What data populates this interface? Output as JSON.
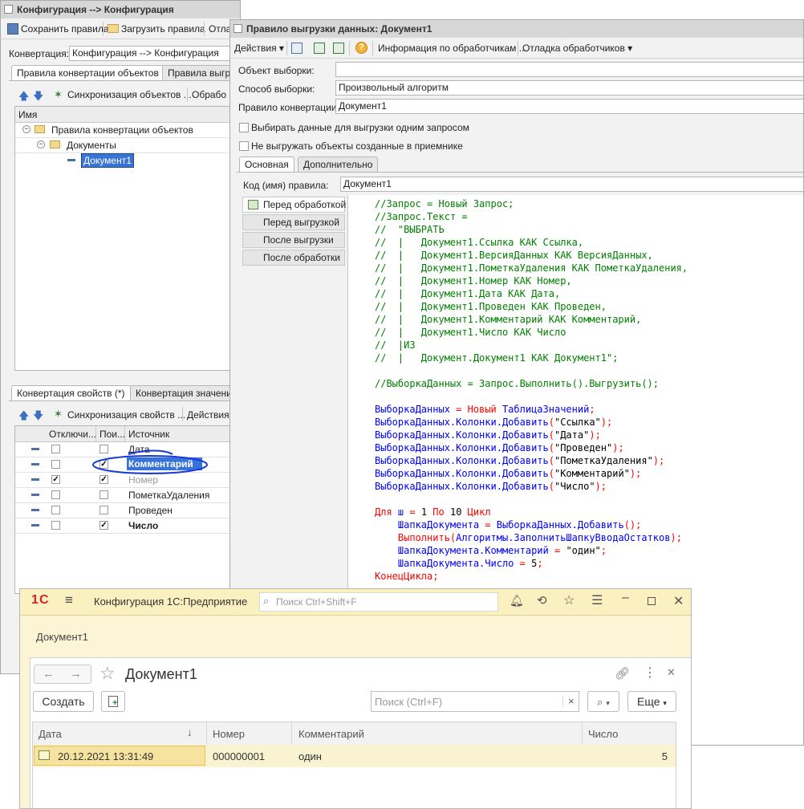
{
  "main_window": {
    "title": "Конфигурация --> Конфигурация",
    "toolbar": {
      "save": "Сохранить правила",
      "load": "Загрузить правила",
      "cut": "Отла"
    },
    "conversion_label": "Конвертация:",
    "conversion_value": "Конфигурация --> Конфигурация",
    "tabs": [
      "Правила конвертации объектов",
      "Правила выгру"
    ],
    "tree_toolbar": {
      "sync": "Синхронизация объектов ...",
      "process": "Обрабо"
    },
    "tree_header": "Имя",
    "tree": [
      {
        "label": "Правила конвертации объектов"
      },
      {
        "label": "Документы"
      },
      {
        "label": "Документ1"
      }
    ],
    "bottom_tabs": [
      "Конвертация свойств (*)",
      "Конвертация значени"
    ],
    "prop_toolbar": {
      "sync": "Синхронизация свойств ...",
      "actions": "Действия"
    },
    "prop_headers": [
      "Отключи...",
      "Пои...",
      "Источник"
    ],
    "prop_rows": [
      {
        "disabled": false,
        "search": false,
        "source": "Дата"
      },
      {
        "disabled": false,
        "search": true,
        "source": "Комментарий"
      },
      {
        "disabled": true,
        "search": true,
        "source": "Номер"
      },
      {
        "disabled": false,
        "search": false,
        "source": "ПометкаУдаления"
      },
      {
        "disabled": false,
        "search": false,
        "source": "Проведен"
      },
      {
        "disabled": false,
        "search": true,
        "source": "Число"
      }
    ]
  },
  "rule_window": {
    "title": "Правило выгрузки данных: Документ1",
    "toolbar": {
      "actions": "Действия",
      "info": "Информация по обработчикам ...",
      "debug": "Отладка обработчиков"
    },
    "fields": {
      "object_label": "Объект выборки:",
      "object_value": "",
      "method_label": "Способ выборки:",
      "method_value": "Произвольный алгоритм",
      "rule_label": "Правило конвертации:",
      "rule_value": "Документ1"
    },
    "checks": {
      "one_query": "Выбирать данные для выгрузки одним запросом",
      "no_export": "Не выгружать объекты созданные в приемнике"
    },
    "tabs": [
      "Основная",
      "Дополнительно"
    ],
    "code_label": "Код (имя) правила:",
    "code_value": "Документ1",
    "handlers": [
      "Перед обработкой",
      "Перед выгрузкой",
      "После выгрузки",
      "После обработки"
    ]
  },
  "code_lines": [
    [
      [
        "com",
        "//Запрос = Новый Запрос;"
      ]
    ],
    [
      [
        "com",
        "//Запрос.Текст ="
      ]
    ],
    [
      [
        "com",
        "//  \"ВЫБРАТЬ"
      ]
    ],
    [
      [
        "com",
        "//  |   Документ1.Ссылка КАК Ссылка,"
      ]
    ],
    [
      [
        "com",
        "//  |   Документ1.ВерсияДанных КАК ВерсияДанных,"
      ]
    ],
    [
      [
        "com",
        "//  |   Документ1.ПометкаУдаления КАК ПометкаУдаления,"
      ]
    ],
    [
      [
        "com",
        "//  |   Документ1.Номер КАК Номер,"
      ]
    ],
    [
      [
        "com",
        "//  |   Документ1.Дата КАК Дата,"
      ]
    ],
    [
      [
        "com",
        "//  |   Документ1.Проведен КАК Проведен,"
      ]
    ],
    [
      [
        "com",
        "//  |   Документ1.Комментарий КАК Комментарий,"
      ]
    ],
    [
      [
        "com",
        "//  |   Документ1.Число КАК Число"
      ]
    ],
    [
      [
        "com",
        "//  |ИЗ"
      ]
    ],
    [
      [
        "com",
        "//  |   Документ.Документ1 КАК Документ1\";"
      ]
    ],
    [],
    [
      [
        "com",
        "//ВыборкаДанных = Запрос.Выполнить().Выгрузить();"
      ]
    ],
    [],
    [
      [
        "id",
        "ВыборкаДанных"
      ],
      [
        "kw",
        " = "
      ],
      [
        "kw",
        "Новый"
      ],
      [
        "id",
        " ТаблицаЗначений"
      ],
      [
        "kw",
        ";"
      ]
    ],
    [
      [
        "id",
        "ВыборкаДанных.Колонки.Добавить"
      ],
      [
        "kw",
        "("
      ],
      [
        "str",
        "\"Ссылка\""
      ],
      [
        "kw",
        ");"
      ]
    ],
    [
      [
        "id",
        "ВыборкаДанных.Колонки.Добавить"
      ],
      [
        "kw",
        "("
      ],
      [
        "str",
        "\"Дата\""
      ],
      [
        "kw",
        ");"
      ]
    ],
    [
      [
        "id",
        "ВыборкаДанных.Колонки.Добавить"
      ],
      [
        "kw",
        "("
      ],
      [
        "str",
        "\"Проведен\""
      ],
      [
        "kw",
        ");"
      ]
    ],
    [
      [
        "id",
        "ВыборкаДанных.Колонки.Добавить"
      ],
      [
        "kw",
        "("
      ],
      [
        "str",
        "\"ПометкаУдаления\""
      ],
      [
        "kw",
        ");"
      ]
    ],
    [
      [
        "id",
        "ВыборкаДанных.Колонки.Добавить"
      ],
      [
        "kw",
        "("
      ],
      [
        "str",
        "\"Комментарий\""
      ],
      [
        "kw",
        ");"
      ]
    ],
    [
      [
        "id",
        "ВыборкаДанных.Колонки.Добавить"
      ],
      [
        "kw",
        "("
      ],
      [
        "str",
        "\"Число\""
      ],
      [
        "kw",
        ");"
      ]
    ],
    [],
    [
      [
        "kw",
        "Для"
      ],
      [
        "id",
        " ш"
      ],
      [
        "kw",
        " = "
      ],
      [
        "num",
        "1"
      ],
      [
        "kw",
        " По "
      ],
      [
        "num",
        "10"
      ],
      [
        "kw",
        " Цикл"
      ]
    ],
    [
      [
        "id",
        "    ШапкаДокумента"
      ],
      [
        "kw",
        " = "
      ],
      [
        "id",
        "ВыборкаДанных.Добавить"
      ],
      [
        "kw",
        "();"
      ]
    ],
    [
      [
        "kw",
        "    Выполнить"
      ],
      [
        "kw",
        "("
      ],
      [
        "id",
        "Алгоритмы.ЗаполнитьШапкуВводаОстатков"
      ],
      [
        "kw",
        ");"
      ]
    ],
    [
      [
        "id",
        "    ШапкаДокумента.Комментарий"
      ],
      [
        "kw",
        " = "
      ],
      [
        "str",
        "\"один\""
      ],
      [
        "kw",
        ";"
      ]
    ],
    [
      [
        "id",
        "    ШапкаДокумента.Число"
      ],
      [
        "kw",
        " = "
      ],
      [
        "num",
        "5"
      ],
      [
        "kw",
        ";"
      ]
    ],
    [
      [
        "kw",
        "КонецЦикла;"
      ]
    ]
  ],
  "enterprise": {
    "app_title": "Конфигурация 1С:Предприятие",
    "search_placeholder": "Поиск Ctrl+Shift+F",
    "nav_item": "Документ1",
    "form_title": "Документ1",
    "create_button": "Создать",
    "list_search_placeholder": "Поиск (Ctrl+F)",
    "more_button": "Еще",
    "columns": [
      "Дата",
      "Номер",
      "Комментарий",
      "Число"
    ],
    "rows": [
      {
        "date": "20.12.2021 13:31:49",
        "number": "000000001",
        "comment": "один",
        "count": "5"
      }
    ]
  }
}
